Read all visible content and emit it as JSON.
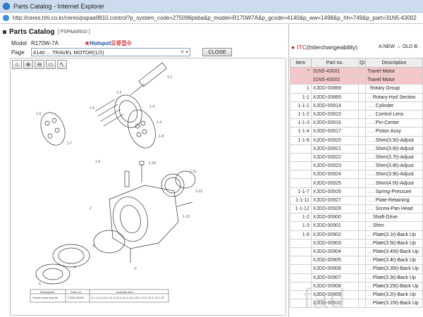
{
  "window": {
    "title": "Parts Catalog - Internet Explorer"
  },
  "address": {
    "url": "http://ceres.hhi.co.kr/ceres/pspaa9910.control?p_system_code=275096psba&p_model=R170W7A&p_gcode=4140&p_ww=1498&p_hh=749&p_part=31N5-43002"
  },
  "header": {
    "title": "Parts Catalog",
    "code": "[ PSPAA9910 ]"
  },
  "form": {
    "model_label": "Model",
    "model_value": "R170W-7A",
    "hotspot_label": "Hotspot",
    "hotspot_suffix": "오류접수",
    "page_label": "Page",
    "page_value": "4140 ... TRAVEL MOTOR(1/2)",
    "close_label": "CLOSE"
  },
  "toolbar": {
    "icons": [
      "home-icon",
      "zoom-in-icon",
      "zoom-out-icon",
      "print-icon",
      "select-icon"
    ]
  },
  "callouts": [
    "1-1",
    "1-2",
    "1-3",
    "1-4",
    "1-5",
    "1-6",
    "1-7",
    "1-8",
    "1-9",
    "1-10",
    "1-11",
    "1-12",
    "1-13",
    "2",
    "3",
    "4",
    "5",
    "6"
  ],
  "inset_table": {
    "headers": [
      "Description",
      "Parts no.",
      "Included item"
    ],
    "row": [
      "Travel motor seal kit",
      "XJDD-00900",
      "1-1,1-4,1-10,1-11,1-12,1-13,1-15,1-20,1-21,1-73,1-74,1-75"
    ]
  },
  "itc": {
    "marker": "●",
    "prefix": "ITC",
    "rest": "(Interchangeability)"
  },
  "legend": {
    "text": "A:NEW ↔ OLD   B:"
  },
  "table": {
    "headers": [
      "Item",
      "Part no.",
      "Qi",
      "Description"
    ],
    "rows": [
      {
        "item": "*",
        "part": "31N5-43001",
        "desc": "Travel Motor",
        "hl": true
      },
      {
        "item": "",
        "part": "31N5-43002",
        "desc": "Travel Motor",
        "hl": true
      },
      {
        "item": "1",
        "part": "XJDD-00869",
        "desc": ". Rotary Group",
        "hl": false
      },
      {
        "item": "1-1",
        "part": "XJDD-00889",
        "desc": ". . Rotary-Hyd Section",
        "hl": false
      },
      {
        "item": "1-1-1",
        "part": "XJDD-00914",
        "desc": ". . . Cylinder",
        "hl": false
      },
      {
        "item": "1-1-2",
        "part": "XJDD-00915",
        "desc": ". . . Control Lens",
        "hl": false
      },
      {
        "item": "1-1-3",
        "part": "XJDD-00916",
        "desc": ". . . Pin-Center",
        "hl": false
      },
      {
        "item": "1-1-4",
        "part": "XJDD-00917",
        "desc": ". . . Piston Assy",
        "hl": false
      },
      {
        "item": "1-1-6",
        "part": "XJDD-00920",
        "desc": ". . . Shim(3.5t)-Adjust",
        "hl": false
      },
      {
        "item": "",
        "part": "XJDD-00921",
        "desc": ". . . Shim(3.6t)-Adjust",
        "hl": false
      },
      {
        "item": "",
        "part": "XJDD-00922",
        "desc": ". . . Shim(3.7t)-Adjust",
        "hl": false
      },
      {
        "item": "",
        "part": "XJDD-00923",
        "desc": ". . . Shim(3.8t)-Adjust",
        "hl": false
      },
      {
        "item": "",
        "part": "XJDD-00924",
        "desc": ". . . Shim(3.9t)-Adjust",
        "hl": false
      },
      {
        "item": "",
        "part": "XJDD-00925",
        "desc": ". . . Shim(4.0t)-Adjust",
        "hl": false
      },
      {
        "item": "1-1-7",
        "part": "XJDD-00926",
        "desc": ". . . Spring-Pressure",
        "hl": false
      },
      {
        "item": "1-1-11",
        "part": "XJDD-00927",
        "desc": ". . . Plate-Retaining",
        "hl": false
      },
      {
        "item": "1-1-12",
        "part": "XJDD-00928",
        "desc": ". . . Screw-Pan Head",
        "hl": false
      },
      {
        "item": "1-2",
        "part": "XJDD-00900",
        "desc": ". . Shaft-Drive",
        "hl": false
      },
      {
        "item": "1-3",
        "part": "XJDD-00901",
        "desc": ". . Shim",
        "hl": false
      },
      {
        "item": "1-6",
        "part": "XJDD-00902",
        "desc": ". . Plate(3.1t)-Back Up",
        "hl": false
      },
      {
        "item": "",
        "part": "XJDD-00903",
        "desc": ". . Plate(3.5t)-Back Up",
        "hl": false
      },
      {
        "item": "",
        "part": "XJDD-00904",
        "desc": ". . Plate(3.45t)-Back Up",
        "hl": false
      },
      {
        "item": "",
        "part": "XJDD-00905",
        "desc": ". . Plate(3.4t)-Back Up",
        "hl": false
      },
      {
        "item": "",
        "part": "XJDD-00906",
        "desc": ". . Plate(3.35t)-Back Up",
        "hl": false
      },
      {
        "item": "",
        "part": "XJDD-00907",
        "desc": ". . Plate(3.3t)-Back Up",
        "hl": false
      },
      {
        "item": "",
        "part": "XJDD-00908",
        "desc": ". . Plate(3.25t)-Back Up",
        "hl": false
      },
      {
        "item": "",
        "part": "XJDD-00909",
        "desc": ". . Plate(3.2t)-Back Up",
        "hl": false
      },
      {
        "item": "",
        "part": "XJDD-00910",
        "desc": ". . Plate(3.15t)-Back Up",
        "hl": false
      }
    ]
  },
  "watermark": {
    "text": "fad"
  }
}
